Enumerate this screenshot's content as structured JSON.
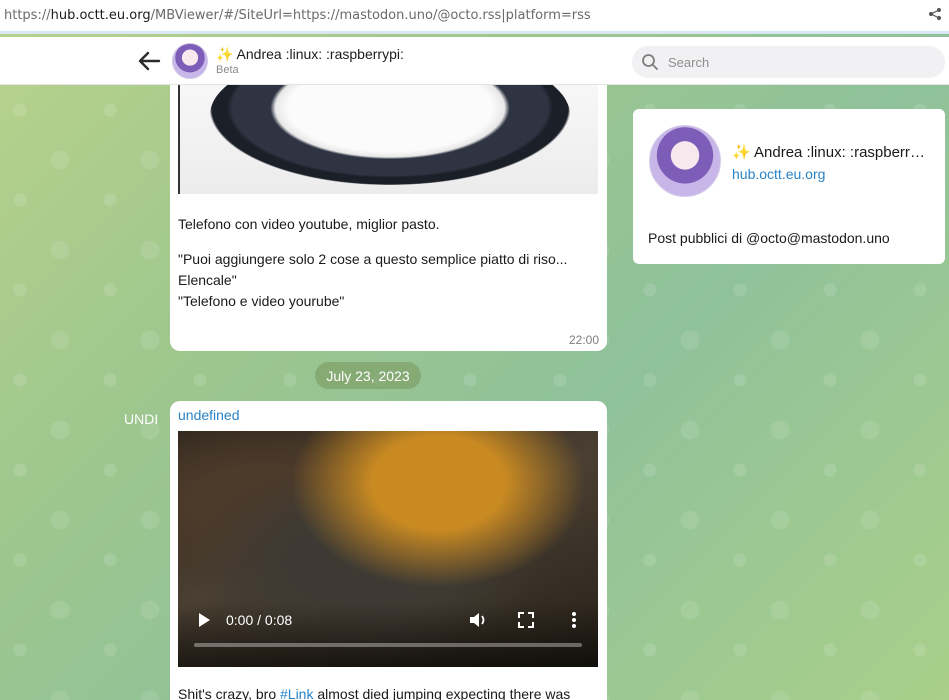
{
  "browser": {
    "url_scheme": "https://",
    "url_host": "hub.octt.eu.org",
    "url_path": "/MBViewer/#/SiteUrl=https://mastodon.uno/@octo.rss|platform=rss",
    "share_icon": "share-icon"
  },
  "header": {
    "title": "✨ Andrea :linux: :raspberrypi:",
    "subtitle": "Beta",
    "search_placeholder": "Search"
  },
  "messages": [
    {
      "image": "rice-plate-image",
      "lines": [
        "Telefono con video youtube, miglior pasto.",
        "\"Puoi aggiungere solo 2 cose a questo semplice piatto di riso...",
        "Elencale\"",
        "\"Telefono e video yourube\""
      ],
      "time": "22:00"
    },
    {
      "author": "undefined",
      "video": {
        "time_readout": "0:00 / 0:08",
        "progress": 0.0
      },
      "text_before": "Shit's crazy, bro ",
      "link": "#Link",
      "text_after": " almost died jumping expecting there was"
    }
  ],
  "date_separator": "July 23, 2023",
  "side_label": "UNDI",
  "profile": {
    "name": "✨ Andrea :linux: :raspberrypi:",
    "host": "hub.octt.eu.org",
    "description": "Post pubblici di @octo@mastodon.uno"
  }
}
